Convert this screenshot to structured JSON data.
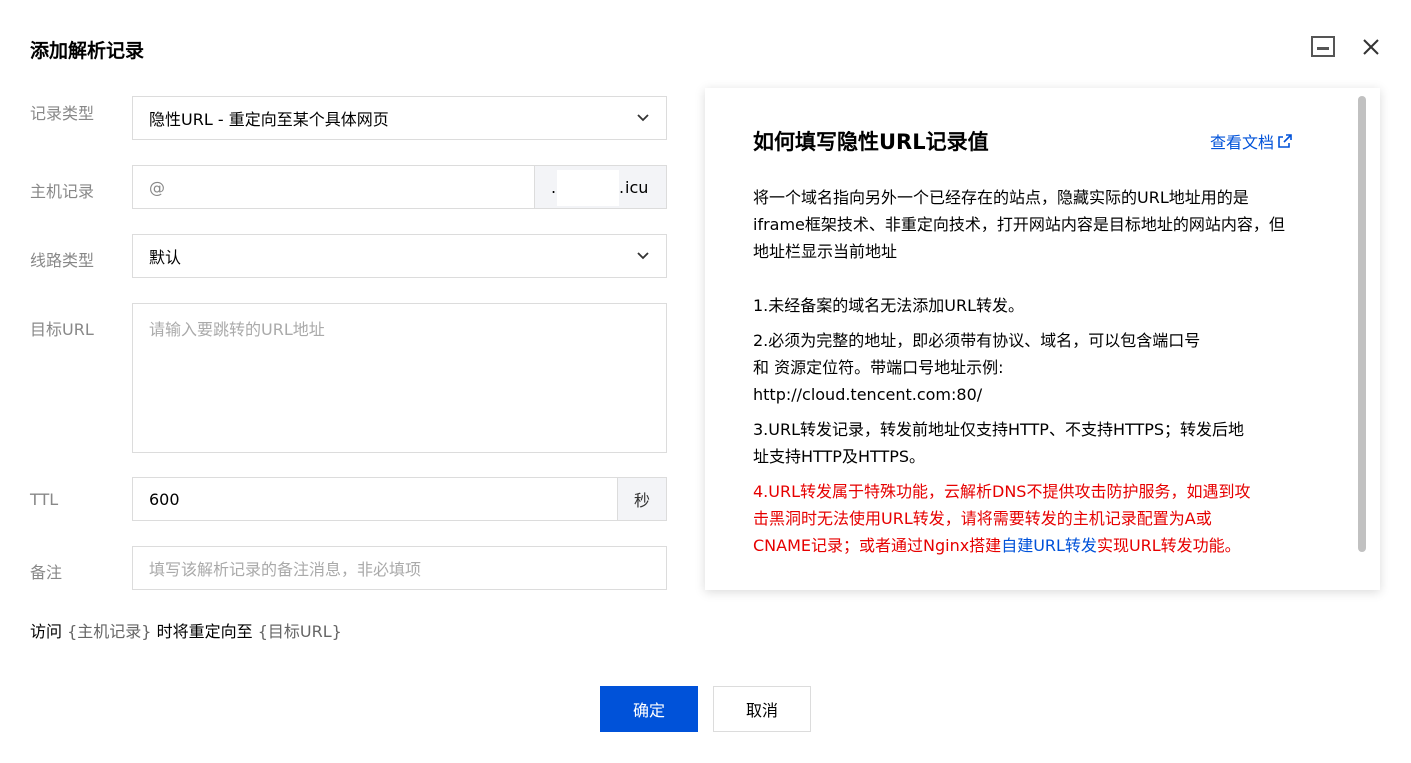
{
  "dialog": {
    "title": "添加解析记录"
  },
  "form": {
    "record_type": {
      "label": "记录类型",
      "value": "隐性URL - 重定向至某个具体网页"
    },
    "host": {
      "label": "主机记录",
      "value": "@",
      "suffix": "icu"
    },
    "line_type": {
      "label": "线路类型",
      "value": "默认"
    },
    "target_url": {
      "label": "目标URL",
      "placeholder": "请输入要跳转的URL地址"
    },
    "ttl": {
      "label": "TTL",
      "value": "600",
      "unit": "秒"
    },
    "remark": {
      "label": "备注",
      "placeholder": "填写该解析记录的备注消息，非必填项"
    }
  },
  "redirect_hint": {
    "prefix": "访问",
    "host_ph": "{主机记录}",
    "middle": "时将重定向至",
    "target_ph": "{目标URL}"
  },
  "buttons": {
    "confirm": "确定",
    "cancel": "取消"
  },
  "help": {
    "title": "如何填写隐性URL记录值",
    "doc_link": "查看文档",
    "intro": "将一个域名指向另外一个已经存在的站点，隐藏实际的URL地址用的是iframe框架技术、非重定向技术，打开网站内容是目标地址的网站内容，但地址栏显示当前地址",
    "item1": "1.未经备案的域名无法添加URL转发。",
    "item2a": "2.必须为完整的地址，即必须带有协议、域名，可以包含端口号",
    "item2b": "和 资源定位符。带端口号地址示例:",
    "item2c": "http://cloud.tencent.com:80/",
    "item3": "3.URL转发记录，转发前地址仅支持HTTP、不支持HTTPS；转发后地址支持HTTP及HTTPS。",
    "item4a": "4.URL转发属于特殊功能，云解析DNS不提供攻击防护服务，如遇到攻击黑洞时无法使用URL转发，请将需要转发的主机记录配置为A或CNAME记录；或者通过Nginx搭建",
    "item4_link": "自建URL转发",
    "item4b": "实现URL转发功能。"
  },
  "colors": {
    "primary": "#0052d9",
    "warning": "#e60000",
    "label": "#888888"
  }
}
